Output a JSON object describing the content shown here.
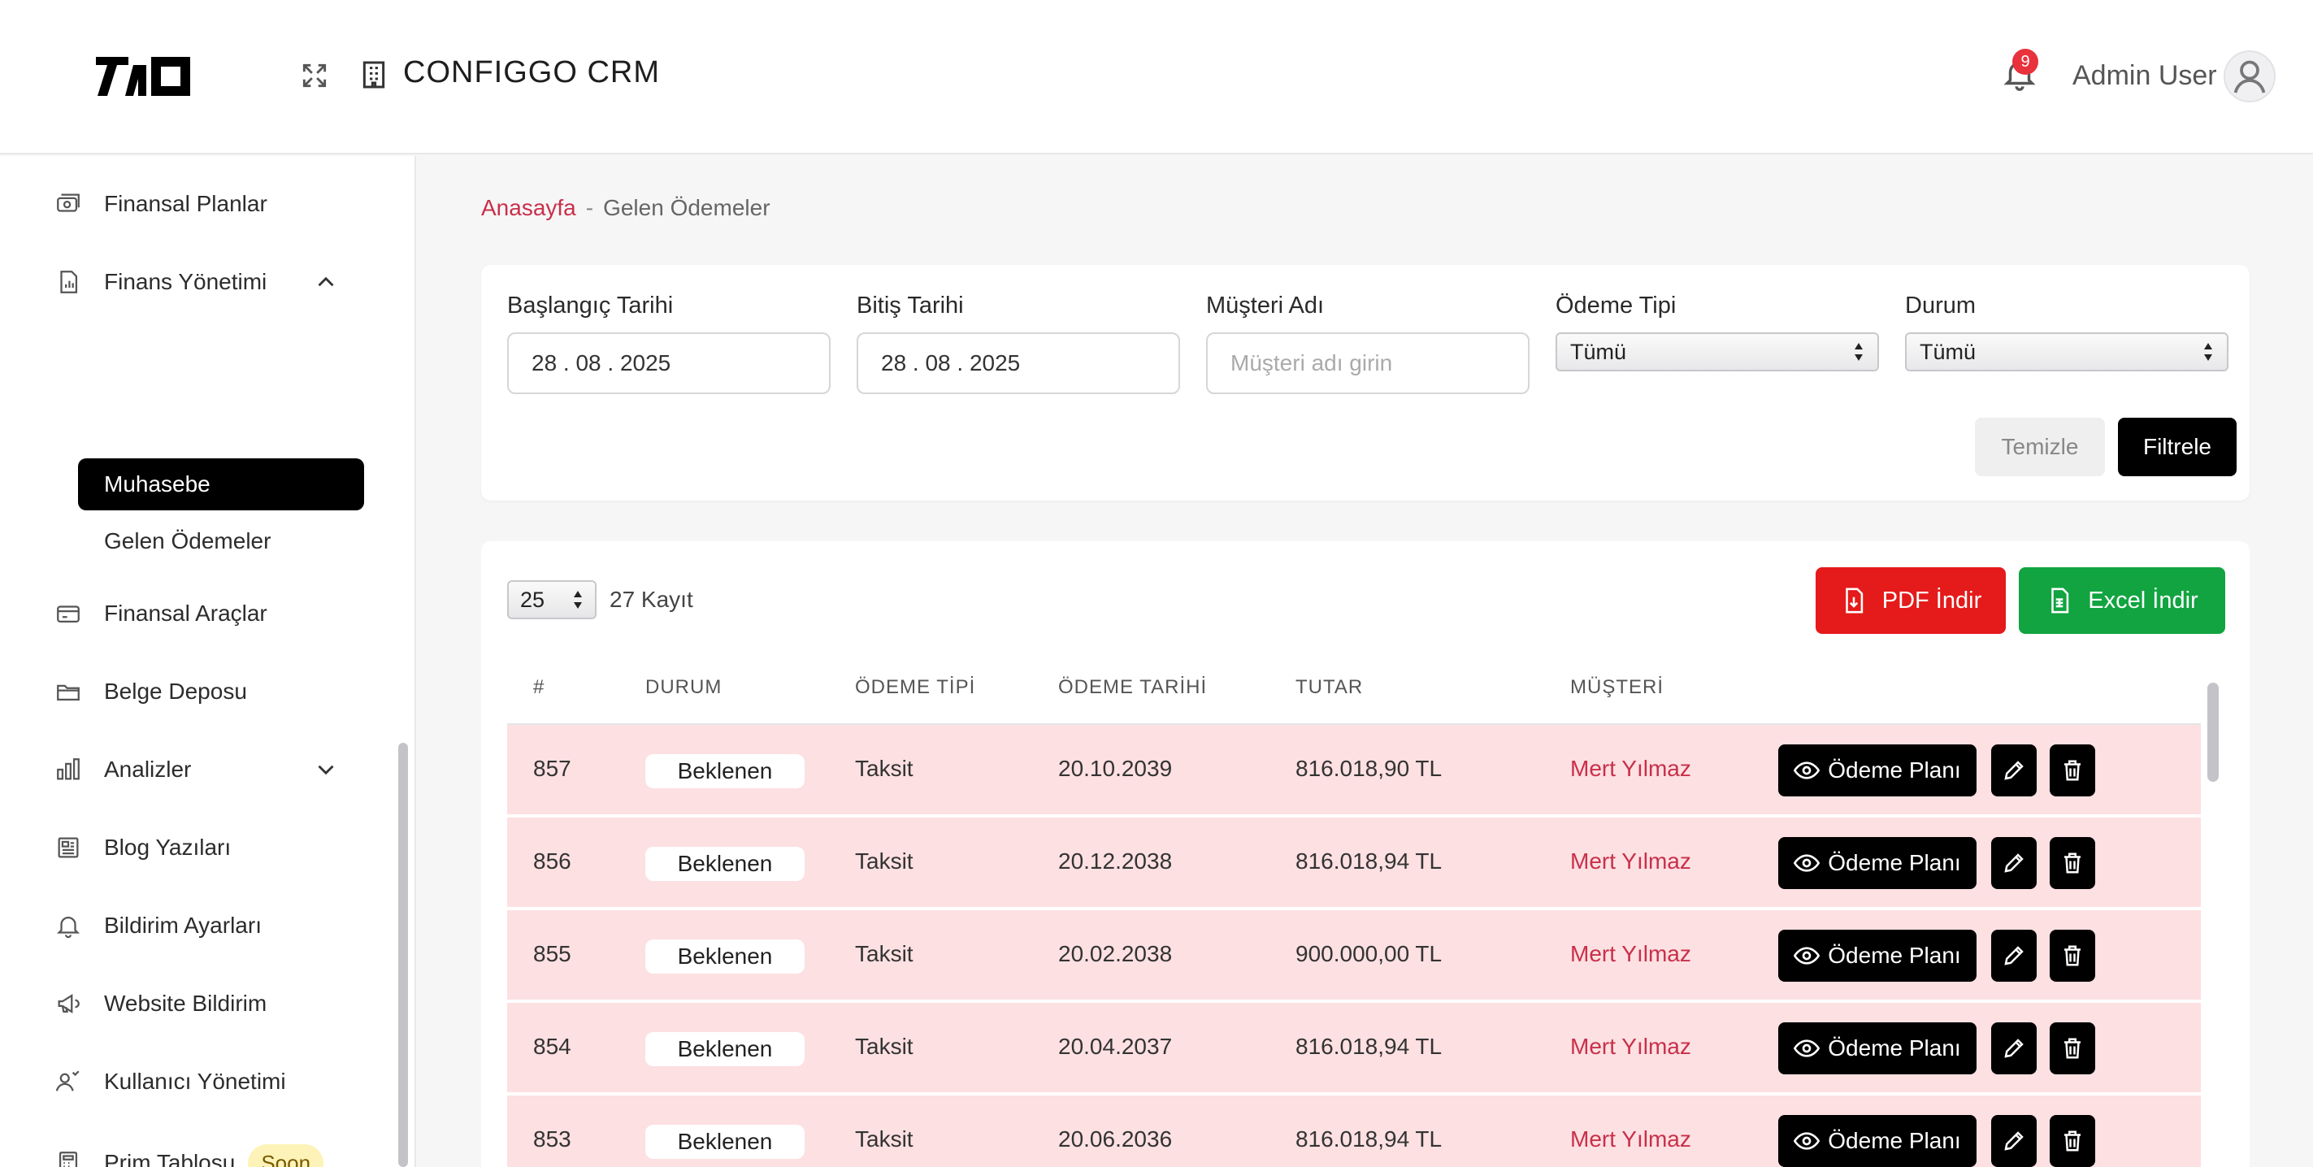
{
  "header": {
    "app_title": "CONFIGGO  CRM",
    "notification_count": "9",
    "user_name": "Admin User"
  },
  "sidebar": {
    "items": [
      {
        "label": "Finansal Planlar",
        "icon": "money-icon"
      },
      {
        "label": "Finans Yönetimi",
        "icon": "report-icon",
        "expanded": true
      },
      {
        "label": "Finansal Araçlar",
        "icon": "card-icon"
      },
      {
        "label": "Belge Deposu",
        "icon": "folder-icon"
      },
      {
        "label": "Analizler",
        "icon": "chart-icon",
        "expanded": false
      },
      {
        "label": "Blog Yazıları",
        "icon": "news-icon"
      },
      {
        "label": "Bildirim Ayarları",
        "icon": "bell-icon"
      },
      {
        "label": "Website Bildirim",
        "icon": "megaphone-icon"
      },
      {
        "label": "Kullanıcı Yönetimi",
        "icon": "users-icon"
      },
      {
        "label": "Prim Tablosu",
        "icon": "calculator-icon",
        "badge": "Soon"
      }
    ],
    "sub_items": [
      {
        "label": "Muhasebe",
        "active": true
      },
      {
        "label": "Gelen Ödemeler",
        "active": false
      }
    ]
  },
  "breadcrumb": {
    "home": "Anasayfa",
    "separator": "-",
    "current": "Gelen Ödemeler"
  },
  "filters": {
    "start_date": {
      "label": "Başlangıç Tarihi",
      "value": "28 . 08 . 2025"
    },
    "end_date": {
      "label": "Bitiş Tarihi",
      "value": "28 . 08 . 2025"
    },
    "customer": {
      "label": "Müşteri Adı",
      "placeholder": "Müşteri adı girin",
      "value": ""
    },
    "payment_type": {
      "label": "Ödeme Tipi",
      "value": "Tümü"
    },
    "status": {
      "label": "Durum",
      "value": "Tümü"
    },
    "clear_label": "Temizle",
    "filter_label": "Filtrele"
  },
  "table": {
    "page_size": "25",
    "record_count": "27 Kayıt",
    "pdf_label": "PDF İndir",
    "excel_label": "Excel İndir",
    "columns": [
      "#",
      "DURUM",
      "ÖDEME TİPİ",
      "ÖDEME TARİHİ",
      "TUTAR",
      "MÜŞTERİ"
    ],
    "plan_label": "Ödeme Planı",
    "rows": [
      {
        "id": "857",
        "status": "Beklenen",
        "type": "Taksit",
        "date": "20.10.2039",
        "amount": "816.018,90 TL",
        "customer": "Mert Yılmaz"
      },
      {
        "id": "856",
        "status": "Beklenen",
        "type": "Taksit",
        "date": "20.12.2038",
        "amount": "816.018,94 TL",
        "customer": "Mert Yılmaz"
      },
      {
        "id": "855",
        "status": "Beklenen",
        "type": "Taksit",
        "date": "20.02.2038",
        "amount": "900.000,00 TL",
        "customer": "Mert Yılmaz"
      },
      {
        "id": "854",
        "status": "Beklenen",
        "type": "Taksit",
        "date": "20.04.2037",
        "amount": "816.018,94 TL",
        "customer": "Mert Yılmaz"
      },
      {
        "id": "853",
        "status": "Beklenen",
        "type": "Taksit",
        "date": "20.06.2036",
        "amount": "816.018,94 TL",
        "customer": "Mert Yılmaz"
      }
    ]
  },
  "colors": {
    "accent": "#c8304a",
    "row_bg": "#fde0e2",
    "pdf_button": "#e51a1a",
    "excel_button": "#11a440",
    "badge_red": "#e8323c",
    "soon_badge": "#fdf3b8"
  }
}
